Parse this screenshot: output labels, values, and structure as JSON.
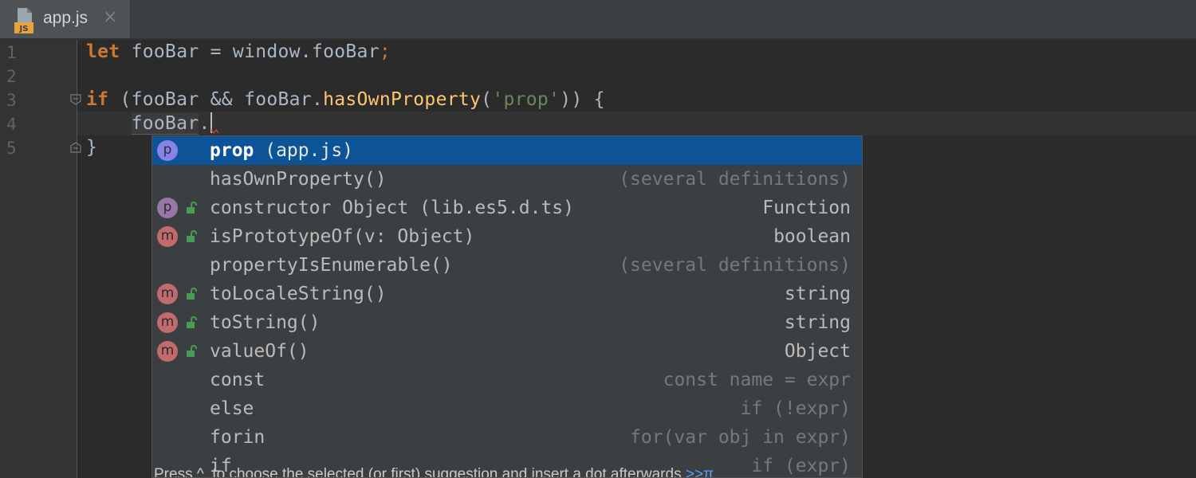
{
  "tab": {
    "label": "app.js",
    "icon_text": "JS",
    "close_glyph": "×"
  },
  "gutter": {
    "line_numbers": [
      "1",
      "2",
      "3",
      "4",
      "5"
    ]
  },
  "code": {
    "line1": {
      "kw": "let",
      "text": " fooBar = window.fooBar",
      "semi": ";"
    },
    "line3": {
      "kw": "if",
      "pre": " (fooBar && fooBar.",
      "fn": "hasOwnProperty",
      "open": "(",
      "str": "'prop'",
      "post": ")) {"
    },
    "line4": {
      "indent": "    ",
      "ident": "fooBar",
      "dot": "."
    },
    "line5": {
      "text": "}"
    }
  },
  "completion": {
    "items": [
      {
        "icon": "p",
        "lock": false,
        "name": "prop",
        "location": " (app.js)",
        "type": "",
        "muted": false
      },
      {
        "icon": "",
        "lock": false,
        "name": "hasOwnProperty()",
        "location": "",
        "type": "(several definitions)",
        "muted": true
      },
      {
        "icon": "p",
        "lock": true,
        "name": "constructor Object (lib.es5.d.ts)",
        "location": "",
        "type": "Function",
        "muted": false
      },
      {
        "icon": "m",
        "lock": true,
        "name": "isPrototypeOf(v: Object)",
        "location": "",
        "type": "boolean",
        "muted": false
      },
      {
        "icon": "",
        "lock": false,
        "name": "propertyIsEnumerable()",
        "location": "",
        "type": "(several definitions)",
        "muted": true
      },
      {
        "icon": "m",
        "lock": true,
        "name": "toLocaleString()",
        "location": "",
        "type": "string",
        "muted": false
      },
      {
        "icon": "m",
        "lock": true,
        "name": "toString()",
        "location": "",
        "type": "string",
        "muted": false
      },
      {
        "icon": "m",
        "lock": true,
        "name": "valueOf()",
        "location": "",
        "type": "Object",
        "muted": false
      },
      {
        "icon": "",
        "lock": false,
        "name": "const",
        "location": "",
        "type": "const name = expr",
        "muted": true
      },
      {
        "icon": "",
        "lock": false,
        "name": "else",
        "location": "",
        "type": "if (!expr)",
        "muted": true
      },
      {
        "icon": "",
        "lock": false,
        "name": "forin",
        "location": "",
        "type": "for(var obj in expr)",
        "muted": true
      },
      {
        "icon": "",
        "lock": false,
        "name": "if",
        "location": "",
        "type": "if (expr)",
        "muted": true
      }
    ],
    "hint_text": "Press ^. to choose the selected (or first) suggestion and insert a dot afterwards ",
    "hint_link": ">>",
    "hint_pi": "π"
  },
  "colors": {
    "background": "#2b2b2b",
    "keyword": "#cc7832",
    "function": "#ffc66d",
    "string": "#6a8759",
    "selection": "#0d5398",
    "property_badge": "#9876aa",
    "method_badge": "#c26b6f",
    "lock": "#499c54"
  },
  "icons": {
    "tab": "javascript-file-icon",
    "close": "close-icon",
    "fold": "fold-icon",
    "lock": "unlocked-icon"
  }
}
